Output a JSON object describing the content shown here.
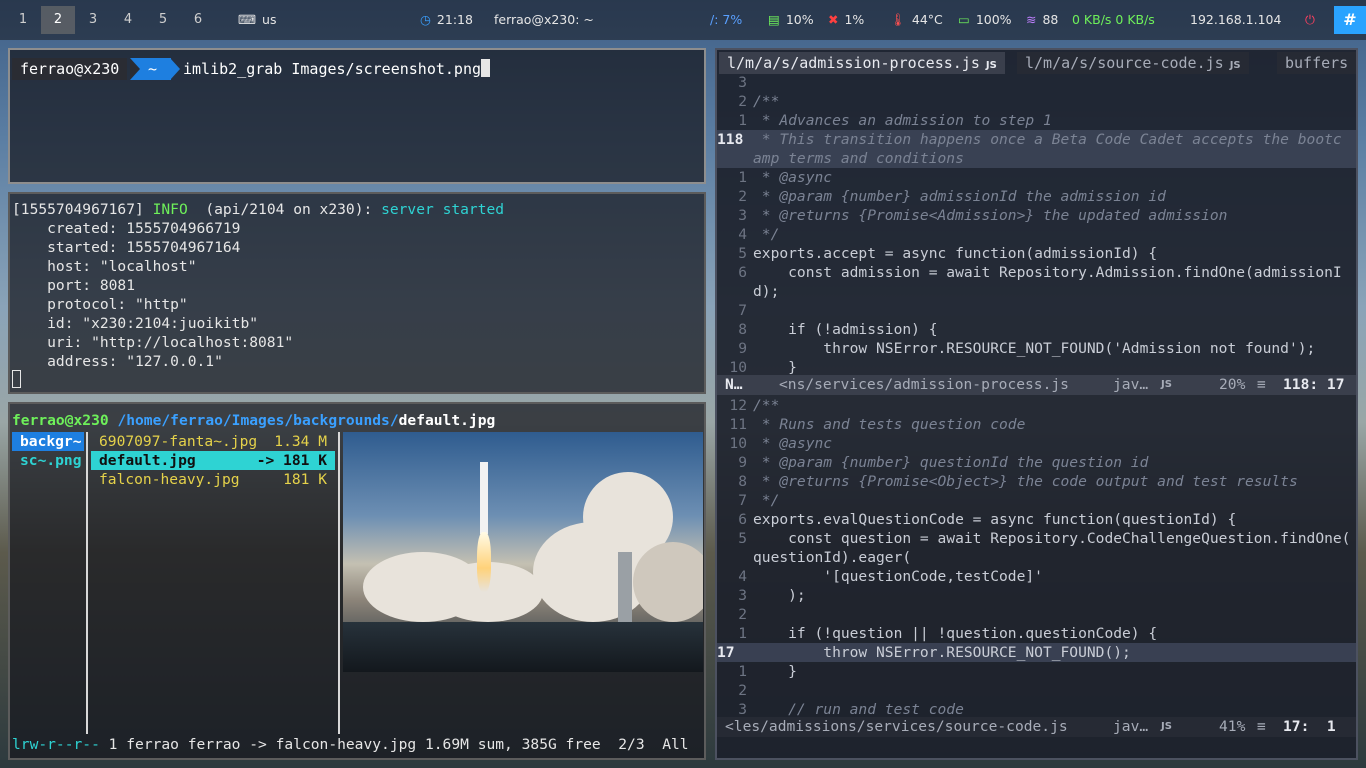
{
  "topbar": {
    "workspaces": [
      "1",
      "2",
      "3",
      "4",
      "5",
      "6"
    ],
    "active_workspace": "2",
    "keyboard_icon": "keyboard-icon",
    "keyboard_layout": "us",
    "clock_icon": "clock-icon",
    "time": "21:18",
    "window_title": "ferrao@x230: ~",
    "disk": "/: 7%",
    "memory": "10%",
    "cpu": "1%",
    "temperature": "44°C",
    "battery": "100%",
    "wifi": "88",
    "net_speed": "0 KB/s 0 KB/s",
    "ip": "192.168.1.104",
    "power_icon": "power-icon",
    "slack_icon": "slack-icon",
    "colors": {
      "active_ws": "#6e6e6e",
      "slack": "#2aa3ff",
      "accent_blue": "#1e7fe0"
    }
  },
  "terminal1": {
    "user": "ferrao@x230",
    "dir": "~",
    "command": "imlib2_grab Images/screenshot.png"
  },
  "terminal2": {
    "ts": "[1555704967167]",
    "level": "INFO",
    "source": "(api/2104 on x230):",
    "msg": "server started",
    "lines": [
      "    created: 1555704966719",
      "    started: 1555704967164",
      "    host: \"localhost\"",
      "    port: 8081",
      "    protocol: \"http\"",
      "    id: \"x230:2104:juoikitb\"",
      "    uri: \"http://localhost:8081\"",
      "    address: \"127.0.0.1\""
    ]
  },
  "ranger": {
    "user": "ferrao@x230",
    "path": "/home/ferrao/Images/backgrounds/",
    "file": "default.jpg",
    "parent": [
      {
        "name": "backgr~",
        "selected": true
      },
      {
        "name": "sc~.png",
        "selected": false
      }
    ],
    "files": [
      {
        "name": "6907097-fanta~.jpg",
        "size": "1.34 M",
        "selected": false
      },
      {
        "name": "default.jpg",
        "size": "-> 181 K",
        "selected": true
      },
      {
        "name": "falcon-heavy.jpg",
        "size": "181 K",
        "selected": false
      }
    ],
    "status_perms": "lrw-r--r--",
    "status_text": "1 ferrao ferrao -> falcon-heavy.jpg 1.69M sum, 385G free  2/3  All"
  },
  "editor": {
    "tabs": [
      {
        "label": "l/m/a/s/admission-process.js",
        "badge": "JS"
      },
      {
        "label": "l/m/a/s/source-code.js",
        "badge": "JS"
      },
      {
        "label": "buffers",
        "badge": ""
      }
    ],
    "top_lines": [
      {
        "n": "3",
        "t": "",
        "k": "plain"
      },
      {
        "n": "2",
        "t": "/**",
        "k": "cmt"
      },
      {
        "n": "1",
        "t": " * Advances an admission to step 1",
        "k": "cmt"
      },
      {
        "n": "118",
        "t": " * This transition happens once a Beta Code Cadet accepts the bootc",
        "k": "cmt",
        "cur": true
      },
      {
        "n": "",
        "t": "amp terms and conditions",
        "k": "cmt",
        "hl": true
      },
      {
        "n": "1",
        "t": " * @async",
        "k": "cmt"
      },
      {
        "n": "2",
        "t": " * @param {number} admissionId the admission id",
        "k": "cmt"
      },
      {
        "n": "3",
        "t": " * @returns {Promise<Admission>} the updated admission",
        "k": "cmt"
      },
      {
        "n": "4",
        "t": " */",
        "k": "cmt"
      },
      {
        "n": "5",
        "t": "exports.accept = async function(admissionId) {",
        "k": "code"
      },
      {
        "n": "6",
        "t": "    const admission = await Repository.Admission.findOne(admissionI",
        "k": "code"
      },
      {
        "n": "",
        "t": "d);",
        "k": "code"
      },
      {
        "n": "7",
        "t": "",
        "k": "plain"
      },
      {
        "n": "8",
        "t": "    if (!admission) {",
        "k": "code"
      },
      {
        "n": "9",
        "t": "        throw NSError.RESOURCE_NOT_FOUND('Admission not found');",
        "k": "code"
      },
      {
        "n": "10",
        "t": "    }",
        "k": "code"
      }
    ],
    "status1": {
      "mode": "N…",
      "file": "<ns/services/admission-process.js",
      "lang": "jav…",
      "badge": "JS",
      "percent": "20%",
      "pos": "118: 17"
    },
    "bottom_lines": [
      {
        "n": "12",
        "t": "/**",
        "k": "cmt"
      },
      {
        "n": "11",
        "t": " * Runs and tests question code",
        "k": "cmt"
      },
      {
        "n": "10",
        "t": " * @async",
        "k": "cmt"
      },
      {
        "n": "9",
        "t": " * @param {number} questionId the question id",
        "k": "cmt"
      },
      {
        "n": "8",
        "t": " * @returns {Promise<Object>} the code output and test results",
        "k": "cmt"
      },
      {
        "n": "7",
        "t": " */",
        "k": "cmt"
      },
      {
        "n": "6",
        "t": "exports.evalQuestionCode = async function(questionId) {",
        "k": "code"
      },
      {
        "n": "5",
        "t": "    const question = await Repository.CodeChallengeQuestion.findOne(",
        "k": "code"
      },
      {
        "n": "",
        "t": "questionId).eager(",
        "k": "code"
      },
      {
        "n": "4",
        "t": "        '[questionCode,testCode]'",
        "k": "code"
      },
      {
        "n": "3",
        "t": "    );",
        "k": "code"
      },
      {
        "n": "2",
        "t": "",
        "k": "plain"
      },
      {
        "n": "1",
        "t": "    if (!question || !question.questionCode) {",
        "k": "code"
      },
      {
        "n": "17",
        "t": "        throw NSError.RESOURCE_NOT_FOUND();",
        "k": "code",
        "cur": true
      },
      {
        "n": "1",
        "t": "    }",
        "k": "code"
      },
      {
        "n": "2",
        "t": "",
        "k": "plain"
      },
      {
        "n": "3",
        "t": "    // run and test code",
        "k": "cmt"
      }
    ],
    "status2": {
      "file": "<les/admissions/services/source-code.js",
      "lang": "jav…",
      "badge": "JS",
      "percent": "41%",
      "pos": "17:  1"
    }
  }
}
